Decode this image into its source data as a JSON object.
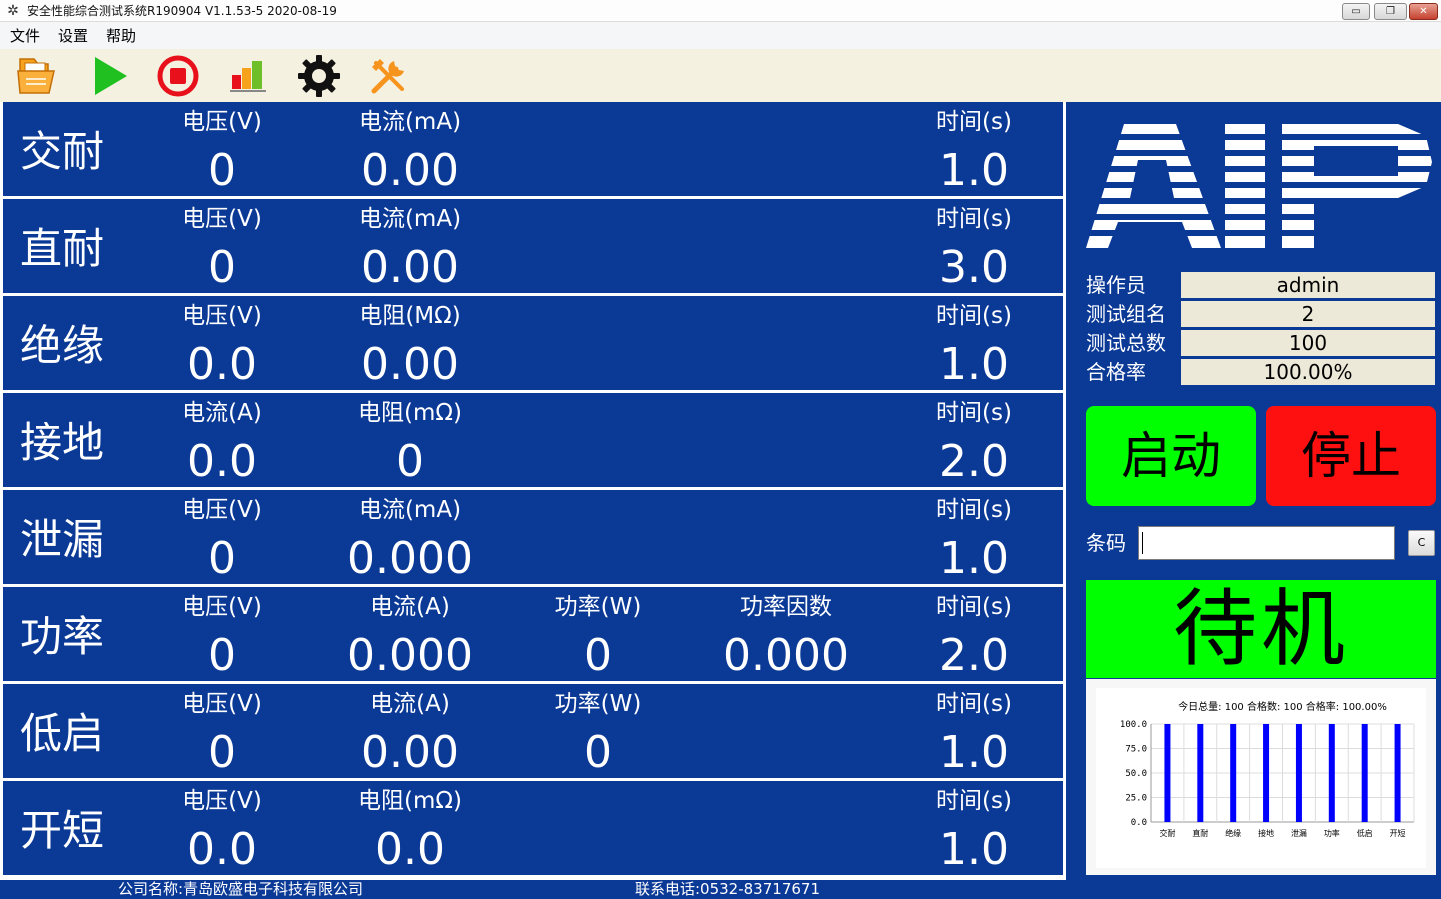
{
  "window": {
    "title": "安全性能综合测试系统R190904 V1.1.53-5 2020-08-19",
    "buttons": {
      "minimize": "▭",
      "restore": "❐",
      "close": "✕"
    }
  },
  "menu": [
    "文件",
    "设置",
    "帮助"
  ],
  "toolbar": {
    "icons": [
      "open-file-icon",
      "play-icon",
      "stop-icon",
      "bar-chart-icon",
      "gear-icon",
      "tools-icon"
    ],
    "colors": {
      "open": "#f5a623",
      "play": "#1fc01f",
      "stop": "#e8101a",
      "chart": "#f7941d",
      "gear": "#111111",
      "tools": "#f7941d"
    }
  },
  "tests": [
    {
      "name": "交耐",
      "headers": [
        "电压(V)",
        "电流(mA)",
        "",
        "",
        "时间(s)"
      ],
      "values": [
        "0",
        "0.00",
        "",
        "",
        "1.0"
      ]
    },
    {
      "name": "直耐",
      "headers": [
        "电压(V)",
        "电流(mA)",
        "",
        "",
        "时间(s)"
      ],
      "values": [
        "0",
        "0.00",
        "",
        "",
        "3.0"
      ]
    },
    {
      "name": "绝缘",
      "headers": [
        "电压(V)",
        "电阻(MΩ)",
        "",
        "",
        "时间(s)"
      ],
      "values": [
        "0.0",
        "0.00",
        "",
        "",
        "1.0"
      ]
    },
    {
      "name": "接地",
      "headers": [
        "电流(A)",
        "电阻(mΩ)",
        "",
        "",
        "时间(s)"
      ],
      "values": [
        "0.0",
        "0",
        "",
        "",
        "2.0"
      ]
    },
    {
      "name": "泄漏",
      "headers": [
        "电压(V)",
        "电流(mA)",
        "",
        "",
        "时间(s)"
      ],
      "values": [
        "0",
        "0.000",
        "",
        "",
        "1.0"
      ]
    },
    {
      "name": "功率",
      "headers": [
        "电压(V)",
        "电流(A)",
        "功率(W)",
        "功率因数",
        "时间(s)"
      ],
      "values": [
        "0",
        "0.000",
        "0",
        "0.000",
        "2.0"
      ]
    },
    {
      "name": "低启",
      "headers": [
        "电压(V)",
        "电流(A)",
        "功率(W)",
        "",
        "时间(s)"
      ],
      "values": [
        "0",
        "0.00",
        "0",
        "",
        "1.0"
      ]
    },
    {
      "name": "开短",
      "headers": [
        "电压(V)",
        "电阻(mΩ)",
        "",
        "",
        "时间(s)"
      ],
      "values": [
        "0.0",
        "0.0",
        "",
        "",
        "1.0"
      ]
    }
  ],
  "info": [
    {
      "label": "操作员",
      "value": "admin"
    },
    {
      "label": "测试组名",
      "value": "2"
    },
    {
      "label": "测试总数",
      "value": "100"
    },
    {
      "label": "合格率",
      "value": "100.00%"
    }
  ],
  "buttons": {
    "start": "启动",
    "stop": "停止",
    "start_color": "#00ff00",
    "stop_color": "#ff1010"
  },
  "barcode": {
    "label": "条码",
    "value": "",
    "clear_label": "C"
  },
  "status": {
    "text": "待机",
    "color": "#00ff00"
  },
  "chart_data": {
    "type": "bar",
    "title": "今日总量: 100  合格数: 100  合格率: 100.00%",
    "categories": [
      "交耐",
      "直耐",
      "绝缘",
      "接地",
      "泄漏",
      "功率",
      "低启",
      "开短"
    ],
    "values": [
      100,
      100,
      100,
      100,
      100,
      100,
      100,
      100
    ],
    "ylim": [
      0,
      100
    ],
    "yticks": [
      "100.0",
      "75.0",
      "50.0",
      "25.0",
      "0.0"
    ],
    "bar_color": "#0000ff",
    "grid": true
  },
  "footer": {
    "company": "公司名称:青岛欧盛电子科技有限公司",
    "phone": "联系电话:0532-83717671"
  }
}
